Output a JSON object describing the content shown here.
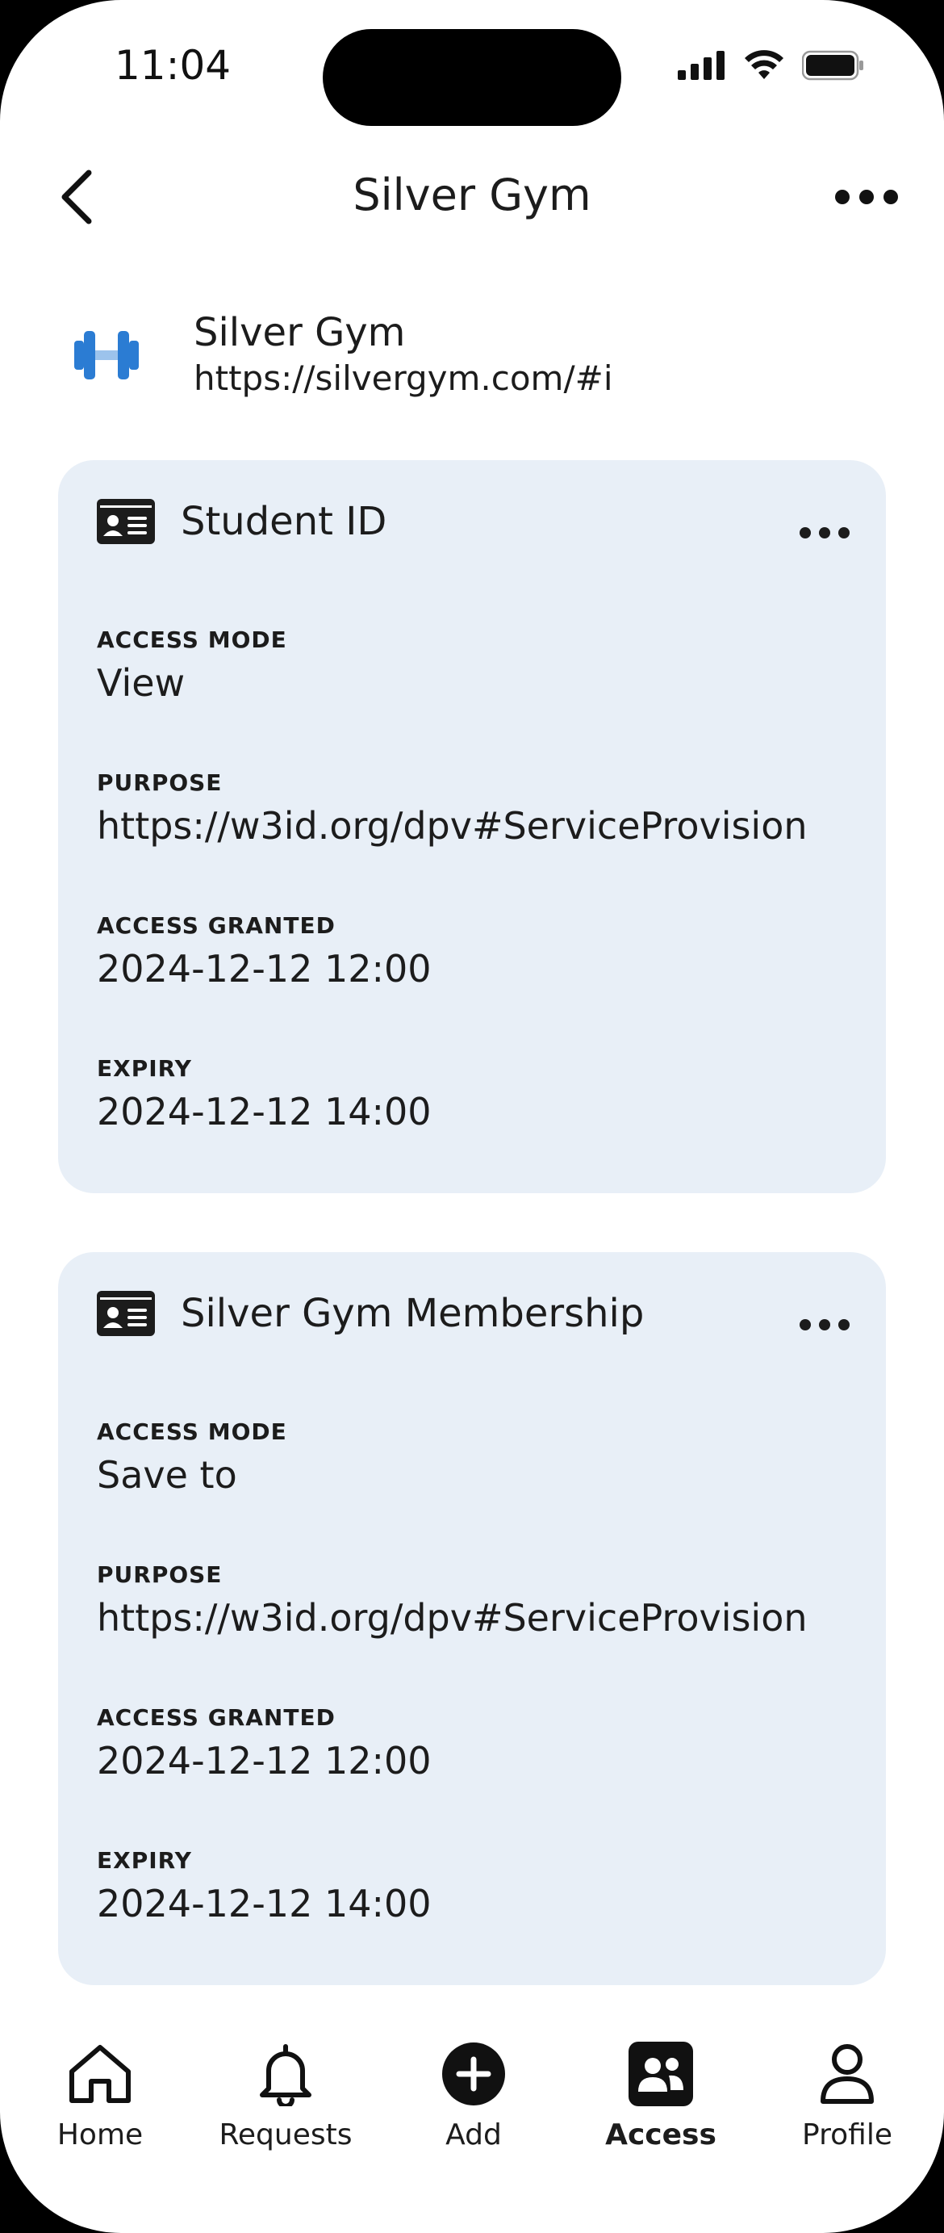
{
  "status_bar": {
    "time": "11:04"
  },
  "nav": {
    "title": "Silver Gym"
  },
  "org": {
    "name": "Silver Gym",
    "url": "https://silvergym.com/#i"
  },
  "cards": [
    {
      "title": "Student ID",
      "fields": [
        {
          "label": "ACCESS MODE",
          "value": "View"
        },
        {
          "label": "PURPOSE",
          "value": "https://w3id.org/dpv#ServiceProvision"
        },
        {
          "label": "ACCESS GRANTED",
          "value": "2024-12-12 12:00"
        },
        {
          "label": "EXPIRY",
          "value": "2024-12-12 14:00"
        }
      ]
    },
    {
      "title": "Silver Gym Membership",
      "fields": [
        {
          "label": "ACCESS MODE",
          "value": "Save to"
        },
        {
          "label": "PURPOSE",
          "value": "https://w3id.org/dpv#ServiceProvision"
        },
        {
          "label": "ACCESS GRANTED",
          "value": "2024-12-12 12:00"
        },
        {
          "label": "EXPIRY",
          "value": "2024-12-12 14:00"
        }
      ]
    }
  ],
  "tabs": [
    {
      "label": "Home",
      "icon": "home-icon",
      "active": false
    },
    {
      "label": "Requests",
      "icon": "bell-icon",
      "active": false
    },
    {
      "label": "Add",
      "icon": "plus-circle-icon",
      "active": false
    },
    {
      "label": "Access",
      "icon": "people-icon",
      "active": true
    },
    {
      "label": "Profile",
      "icon": "person-icon",
      "active": false
    }
  ],
  "colors": {
    "card_background": "#e8eff7",
    "org_icon_blue": "#2b7cd3",
    "org_icon_light": "#9cc3ec"
  }
}
